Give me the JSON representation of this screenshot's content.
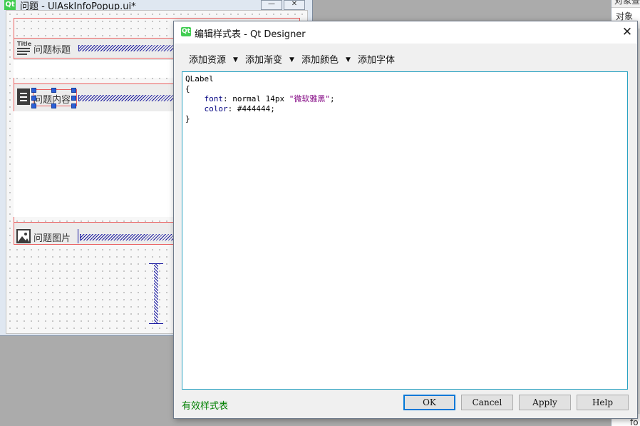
{
  "bg_window": {
    "title": "问题 - UIAskInfoPopup.ui*",
    "logo": "Qt",
    "min_glyph": "—",
    "close_glyph": "✕",
    "title_icon_text": "Title",
    "label_title": "问题标题",
    "label_content": "问题内容",
    "label_image": "问题图片",
    "icons": [
      "title-icon",
      "document-icon",
      "image-icon"
    ]
  },
  "right_panel": {
    "line1": "对象查",
    "line2": "对象",
    "fragments": [
      "fo"
    ]
  },
  "dialog": {
    "logo": "Qt",
    "title": "编辑样式表 - Qt Designer",
    "close_glyph": "✕",
    "toolbar": [
      {
        "label": "添加资源",
        "has_arrow": true
      },
      {
        "label": "添加渐变",
        "has_arrow": true
      },
      {
        "label": "添加颜色",
        "has_arrow": true
      },
      {
        "label": "添加字体",
        "has_arrow": false
      }
    ],
    "arrow_glyph": "▼",
    "editor": {
      "selector": "QLabel",
      "open_brace": "{",
      "indent": "    ",
      "rules": [
        {
          "prop": "font",
          "sep": ": ",
          "value": "normal 14px ",
          "str": "\"微软雅黑\"",
          "end": ";"
        },
        {
          "prop": "color",
          "sep": ": ",
          "value": "#444444",
          "str": "",
          "end": ";"
        }
      ],
      "close_brace": "}"
    },
    "status": "有效样式表",
    "buttons": {
      "ok": "OK",
      "cancel": "Cancel",
      "apply": "Apply",
      "help": "Help"
    },
    "colors": {
      "accent": "#0078d7",
      "editor_border": "#2aa2c2",
      "status": "#008000"
    }
  }
}
